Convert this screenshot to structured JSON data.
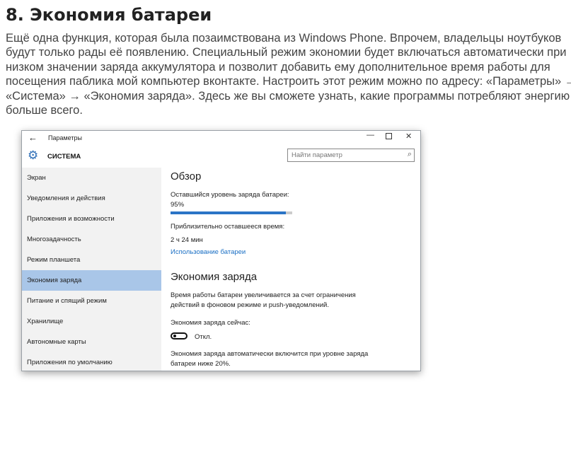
{
  "article": {
    "heading": "8. Экономия батареи",
    "lines": [
      "Ещё одна функция, которая была позаимствована из Windows Phone. Впрочем, владельцы ноутбуков",
      "будут только рады её появлению. Специальный режим экономии будет включаться автоматически при",
      "низком значении заряда аккумулятора и позволит добавить ему дополнительное время работы для",
      "посещения паблика мой компьютер вконтакте. Настроить этот режим можно по адресу: «Параметры» →",
      "«Система» → «Экономия заряда». Здесь же вы сможете узнать, какие программы потребляют энергию",
      "больше всего."
    ]
  },
  "window": {
    "back_glyph": "←",
    "title": "Параметры",
    "min_glyph": "—",
    "close_glyph": "✕",
    "section": "СИСТЕМА",
    "search_placeholder": "Найти параметр",
    "icons": {
      "back": "back-arrow-icon",
      "gear": "gear-icon",
      "search": "search-icon"
    }
  },
  "sidebar": {
    "items": [
      "Экран",
      "Уведомления и действия",
      "Приложения и возможности",
      "Многозадачность",
      "Режим планшета",
      "Экономия заряда",
      "Питание и спящий режим",
      "Хранилище",
      "Автономные карты",
      "Приложения по умолчанию"
    ],
    "active_index": 5
  },
  "content": {
    "overview_title": "Обзор",
    "battery_label": "Оставшийся уровень заряда батареи:",
    "battery_value": "95%",
    "battery_fraction": 0.95,
    "time_label": "Приблизительно оставшееся время:",
    "time_value": "2 ч 24 мин",
    "usage_link": "Использование батареи",
    "saver_title": "Экономия заряда",
    "saver_desc_1": "Время работы батареи увеличивается за счет ограничения",
    "saver_desc_2": "действий в фоновом режиме и push-уведомлений.",
    "saver_now_label": "Экономия заряда сейчас:",
    "toggle_state": "Откл.",
    "auto_note_1": "Экономия заряда автоматически включится при уровне заряда",
    "auto_note_2": "батареи ниже 20%."
  },
  "colors": {
    "accent": "#2b74c6",
    "active_nav": "#a9c6e8",
    "link": "#1a6fc4"
  }
}
